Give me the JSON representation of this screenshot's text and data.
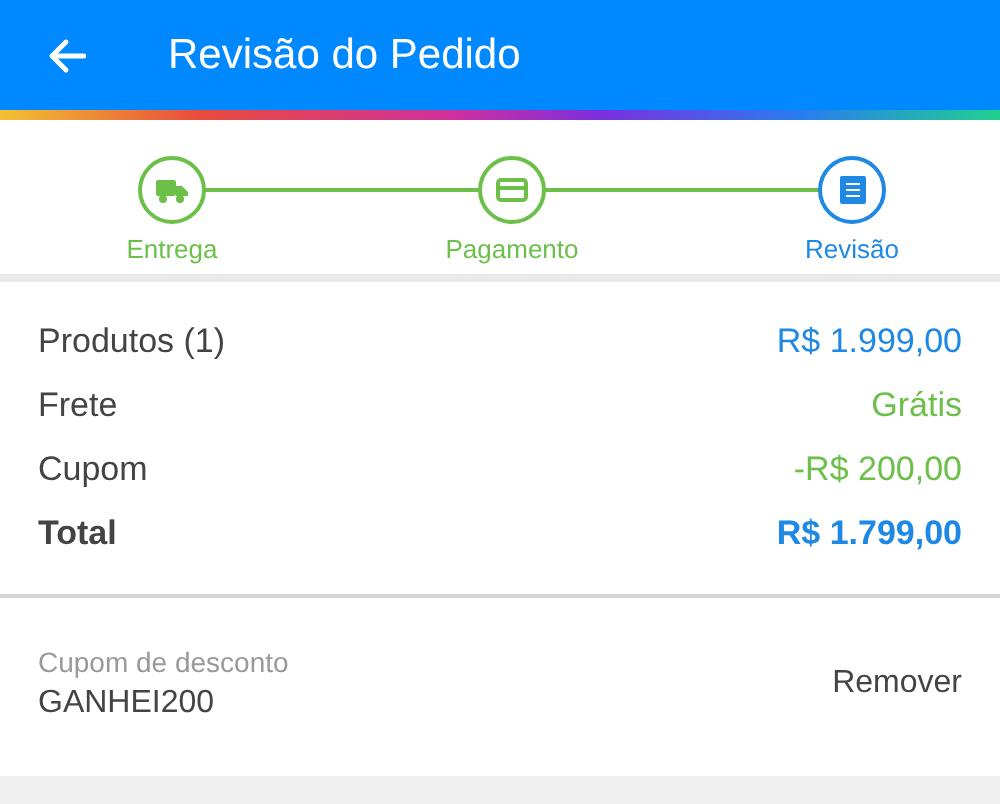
{
  "header": {
    "title": "Revisão do Pedido"
  },
  "steps": [
    {
      "label": "Entrega",
      "kind": "truck",
      "selected": false
    },
    {
      "label": "Pagamento",
      "kind": "card",
      "selected": false
    },
    {
      "label": "Revisão",
      "kind": "document",
      "selected": true
    }
  ],
  "summary": [
    {
      "label": "Produtos (1)",
      "value": "R$ 1.999,00",
      "color": "#1e88e5",
      "bold": false
    },
    {
      "label": "Frete",
      "value": "Grátis",
      "color": "#6cc04a",
      "bold": false
    },
    {
      "label": "Cupom",
      "value": "-R$ 200,00",
      "color": "#6cc04a",
      "bold": false
    },
    {
      "label": "Total",
      "value": "R$ 1.799,00",
      "color": "#1e88e5",
      "bold": true
    }
  ],
  "coupon": {
    "label": "Cupom de desconto",
    "code": "GANHEI200",
    "action": "Remover"
  }
}
